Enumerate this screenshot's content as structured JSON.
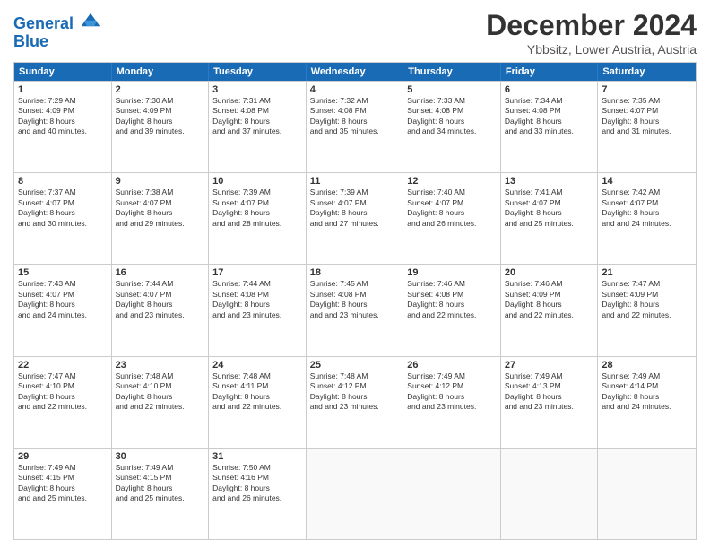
{
  "header": {
    "logo_line1": "General",
    "logo_line2": "Blue",
    "title": "December 2024",
    "subtitle": "Ybbsitz, Lower Austria, Austria"
  },
  "days": [
    "Sunday",
    "Monday",
    "Tuesday",
    "Wednesday",
    "Thursday",
    "Friday",
    "Saturday"
  ],
  "weeks": [
    [
      {
        "num": "1",
        "rise": "7:29 AM",
        "set": "4:09 PM",
        "daylight": "8 hours and 40 minutes."
      },
      {
        "num": "2",
        "rise": "7:30 AM",
        "set": "4:09 PM",
        "daylight": "8 hours and 39 minutes."
      },
      {
        "num": "3",
        "rise": "7:31 AM",
        "set": "4:08 PM",
        "daylight": "8 hours and 37 minutes."
      },
      {
        "num": "4",
        "rise": "7:32 AM",
        "set": "4:08 PM",
        "daylight": "8 hours and 35 minutes."
      },
      {
        "num": "5",
        "rise": "7:33 AM",
        "set": "4:08 PM",
        "daylight": "8 hours and 34 minutes."
      },
      {
        "num": "6",
        "rise": "7:34 AM",
        "set": "4:08 PM",
        "daylight": "8 hours and 33 minutes."
      },
      {
        "num": "7",
        "rise": "7:35 AM",
        "set": "4:07 PM",
        "daylight": "8 hours and 31 minutes."
      }
    ],
    [
      {
        "num": "8",
        "rise": "7:37 AM",
        "set": "4:07 PM",
        "daylight": "8 hours and 30 minutes."
      },
      {
        "num": "9",
        "rise": "7:38 AM",
        "set": "4:07 PM",
        "daylight": "8 hours and 29 minutes."
      },
      {
        "num": "10",
        "rise": "7:39 AM",
        "set": "4:07 PM",
        "daylight": "8 hours and 28 minutes."
      },
      {
        "num": "11",
        "rise": "7:39 AM",
        "set": "4:07 PM",
        "daylight": "8 hours and 27 minutes."
      },
      {
        "num": "12",
        "rise": "7:40 AM",
        "set": "4:07 PM",
        "daylight": "8 hours and 26 minutes."
      },
      {
        "num": "13",
        "rise": "7:41 AM",
        "set": "4:07 PM",
        "daylight": "8 hours and 25 minutes."
      },
      {
        "num": "14",
        "rise": "7:42 AM",
        "set": "4:07 PM",
        "daylight": "8 hours and 24 minutes."
      }
    ],
    [
      {
        "num": "15",
        "rise": "7:43 AM",
        "set": "4:07 PM",
        "daylight": "8 hours and 24 minutes."
      },
      {
        "num": "16",
        "rise": "7:44 AM",
        "set": "4:07 PM",
        "daylight": "8 hours and 23 minutes."
      },
      {
        "num": "17",
        "rise": "7:44 AM",
        "set": "4:08 PM",
        "daylight": "8 hours and 23 minutes."
      },
      {
        "num": "18",
        "rise": "7:45 AM",
        "set": "4:08 PM",
        "daylight": "8 hours and 23 minutes."
      },
      {
        "num": "19",
        "rise": "7:46 AM",
        "set": "4:08 PM",
        "daylight": "8 hours and 22 minutes."
      },
      {
        "num": "20",
        "rise": "7:46 AM",
        "set": "4:09 PM",
        "daylight": "8 hours and 22 minutes."
      },
      {
        "num": "21",
        "rise": "7:47 AM",
        "set": "4:09 PM",
        "daylight": "8 hours and 22 minutes."
      }
    ],
    [
      {
        "num": "22",
        "rise": "7:47 AM",
        "set": "4:10 PM",
        "daylight": "8 hours and 22 minutes."
      },
      {
        "num": "23",
        "rise": "7:48 AM",
        "set": "4:10 PM",
        "daylight": "8 hours and 22 minutes."
      },
      {
        "num": "24",
        "rise": "7:48 AM",
        "set": "4:11 PM",
        "daylight": "8 hours and 22 minutes."
      },
      {
        "num": "25",
        "rise": "7:48 AM",
        "set": "4:12 PM",
        "daylight": "8 hours and 23 minutes."
      },
      {
        "num": "26",
        "rise": "7:49 AM",
        "set": "4:12 PM",
        "daylight": "8 hours and 23 minutes."
      },
      {
        "num": "27",
        "rise": "7:49 AM",
        "set": "4:13 PM",
        "daylight": "8 hours and 23 minutes."
      },
      {
        "num": "28",
        "rise": "7:49 AM",
        "set": "4:14 PM",
        "daylight": "8 hours and 24 minutes."
      }
    ],
    [
      {
        "num": "29",
        "rise": "7:49 AM",
        "set": "4:15 PM",
        "daylight": "8 hours and 25 minutes."
      },
      {
        "num": "30",
        "rise": "7:49 AM",
        "set": "4:15 PM",
        "daylight": "8 hours and 25 minutes."
      },
      {
        "num": "31",
        "rise": "7:50 AM",
        "set": "4:16 PM",
        "daylight": "8 hours and 26 minutes."
      },
      null,
      null,
      null,
      null
    ]
  ]
}
